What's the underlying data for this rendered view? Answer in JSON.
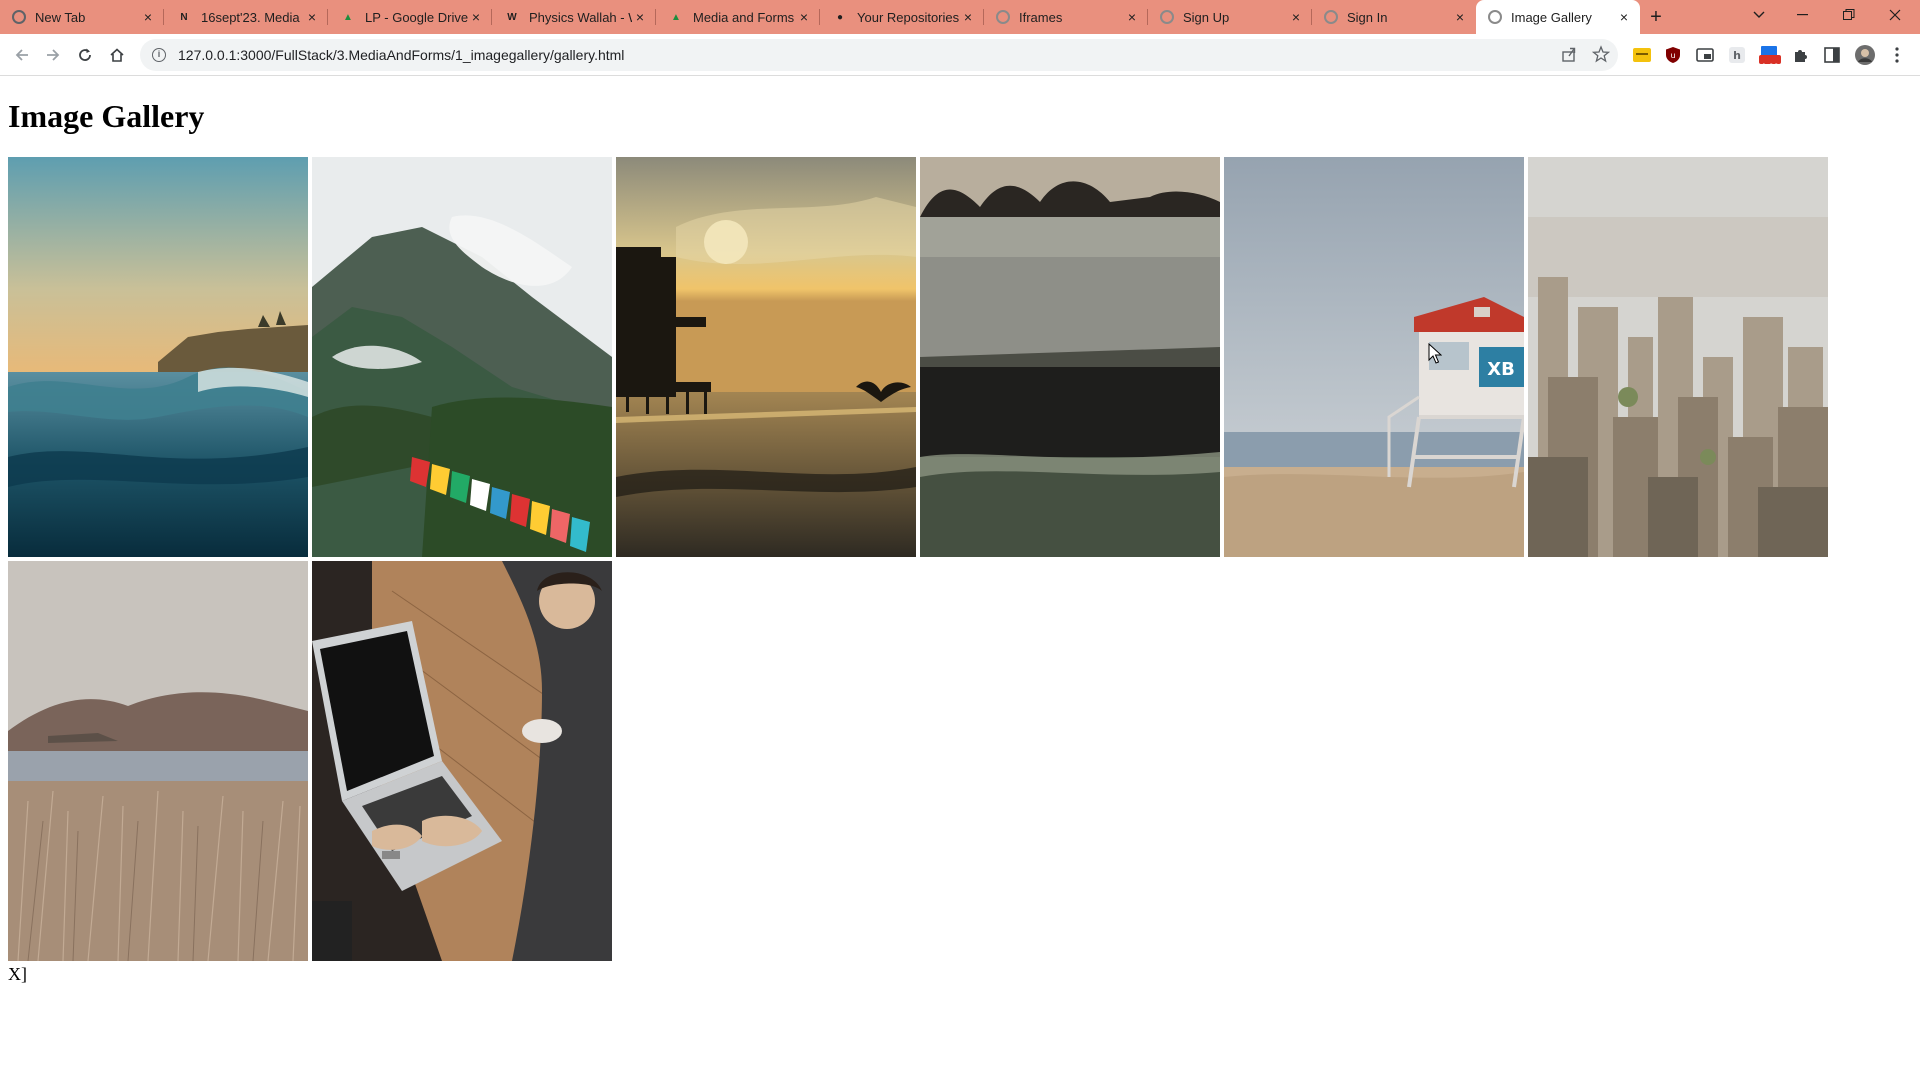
{
  "browser": {
    "tabs": [
      {
        "title": "New Tab",
        "icon": "chrome-icon",
        "color": "#5f6368",
        "glyph": ""
      },
      {
        "title": "16sept'23. Media",
        "icon": "notion-icon",
        "color": "#1f1f1f",
        "glyph": "N"
      },
      {
        "title": "LP - Google Drive",
        "icon": "google-drive-icon",
        "color": "#1e8e3e",
        "glyph": "▲"
      },
      {
        "title": "Physics Wallah - W",
        "icon": "wikipedia-icon",
        "color": "#1f1f1f",
        "glyph": "W"
      },
      {
        "title": "Media and Forms",
        "icon": "google-drive-icon",
        "color": "#1e8e3e",
        "glyph": "▲"
      },
      {
        "title": "Your Repositories",
        "icon": "github-icon",
        "color": "#1f1f1f",
        "glyph": "●"
      },
      {
        "title": "Iframes",
        "icon": "globe-icon",
        "color": "#8a8a8a",
        "glyph": ""
      },
      {
        "title": "Sign Up",
        "icon": "globe-icon",
        "color": "#8a8a8a",
        "glyph": ""
      },
      {
        "title": "Sign In",
        "icon": "globe-icon",
        "color": "#8a8a8a",
        "glyph": ""
      },
      {
        "title": "Image Gallery",
        "icon": "globe-icon",
        "color": "#8a8a8a",
        "glyph": "",
        "active": true
      }
    ],
    "new_tab_label": "+",
    "address": "127.0.0.1:3000/FullStack/3.MediaAndForms/1_imagegallery/gallery.html",
    "extension_badge": "1.00",
    "tabstrip_color": "#e9907e"
  },
  "page": {
    "title": "Image Gallery",
    "images": [
      {
        "name": "ocean-wave-image",
        "subject": "ocean wave at sunset"
      },
      {
        "name": "misty-mountain-prayer-flags-image",
        "subject": "misty mountain with prayer flags"
      },
      {
        "name": "pier-sunset-image",
        "subject": "pier at sunset with seagull"
      },
      {
        "name": "frosty-field-image",
        "subject": "frosty field with treeline"
      },
      {
        "name": "lifeguard-tower-image",
        "subject": "lifeguard tower on beach"
      },
      {
        "name": "city-aerial-image",
        "subject": "aerial city skyline"
      },
      {
        "name": "lake-grass-image",
        "subject": "lake with dry grass and hills"
      },
      {
        "name": "laptop-typing-image",
        "subject": "person typing on laptop"
      }
    ],
    "trailing_text": "X]"
  }
}
